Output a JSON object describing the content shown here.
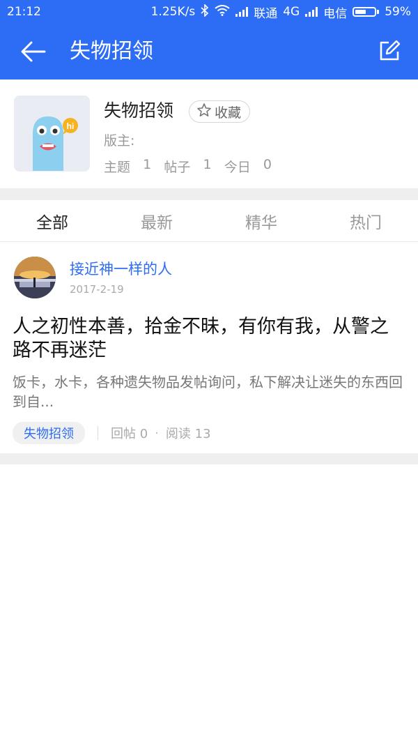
{
  "status_bar": {
    "time": "21:12",
    "speed": "1.25K/s",
    "carrier1": "联通",
    "network": "4G",
    "carrier2": "电信",
    "battery": "59%",
    "battery_level": 0.59
  },
  "app_bar": {
    "title": "失物招领",
    "back_icon": "arrow-left-icon",
    "edit_icon": "edit-icon"
  },
  "board": {
    "name": "失物招领",
    "favorite_label": "收藏",
    "moderator_label": "版主:",
    "stats": [
      {
        "label": "主题",
        "value": "1"
      },
      {
        "label": "帖子",
        "value": "1"
      },
      {
        "label": "今日",
        "value": "0"
      }
    ],
    "logo_badge": "hi"
  },
  "tabs": [
    {
      "label": "全部",
      "active": true
    },
    {
      "label": "最新",
      "active": false
    },
    {
      "label": "精华",
      "active": false
    },
    {
      "label": "热门",
      "active": false
    }
  ],
  "post": {
    "author": "接近神一样的人",
    "date": "2017-2-19",
    "title": "人之初性本善，拾金不昧，有你有我，从警之路不再迷茫",
    "summary": "饭卡，水卡，各种遗失物品发帖询问，私下解决让迷失的东西回到自...",
    "tag": "失物招领",
    "replies": "回帖 0",
    "reads": "阅读 13"
  },
  "colors": {
    "primary": "#2d6cf5",
    "divider": "#efefef"
  }
}
